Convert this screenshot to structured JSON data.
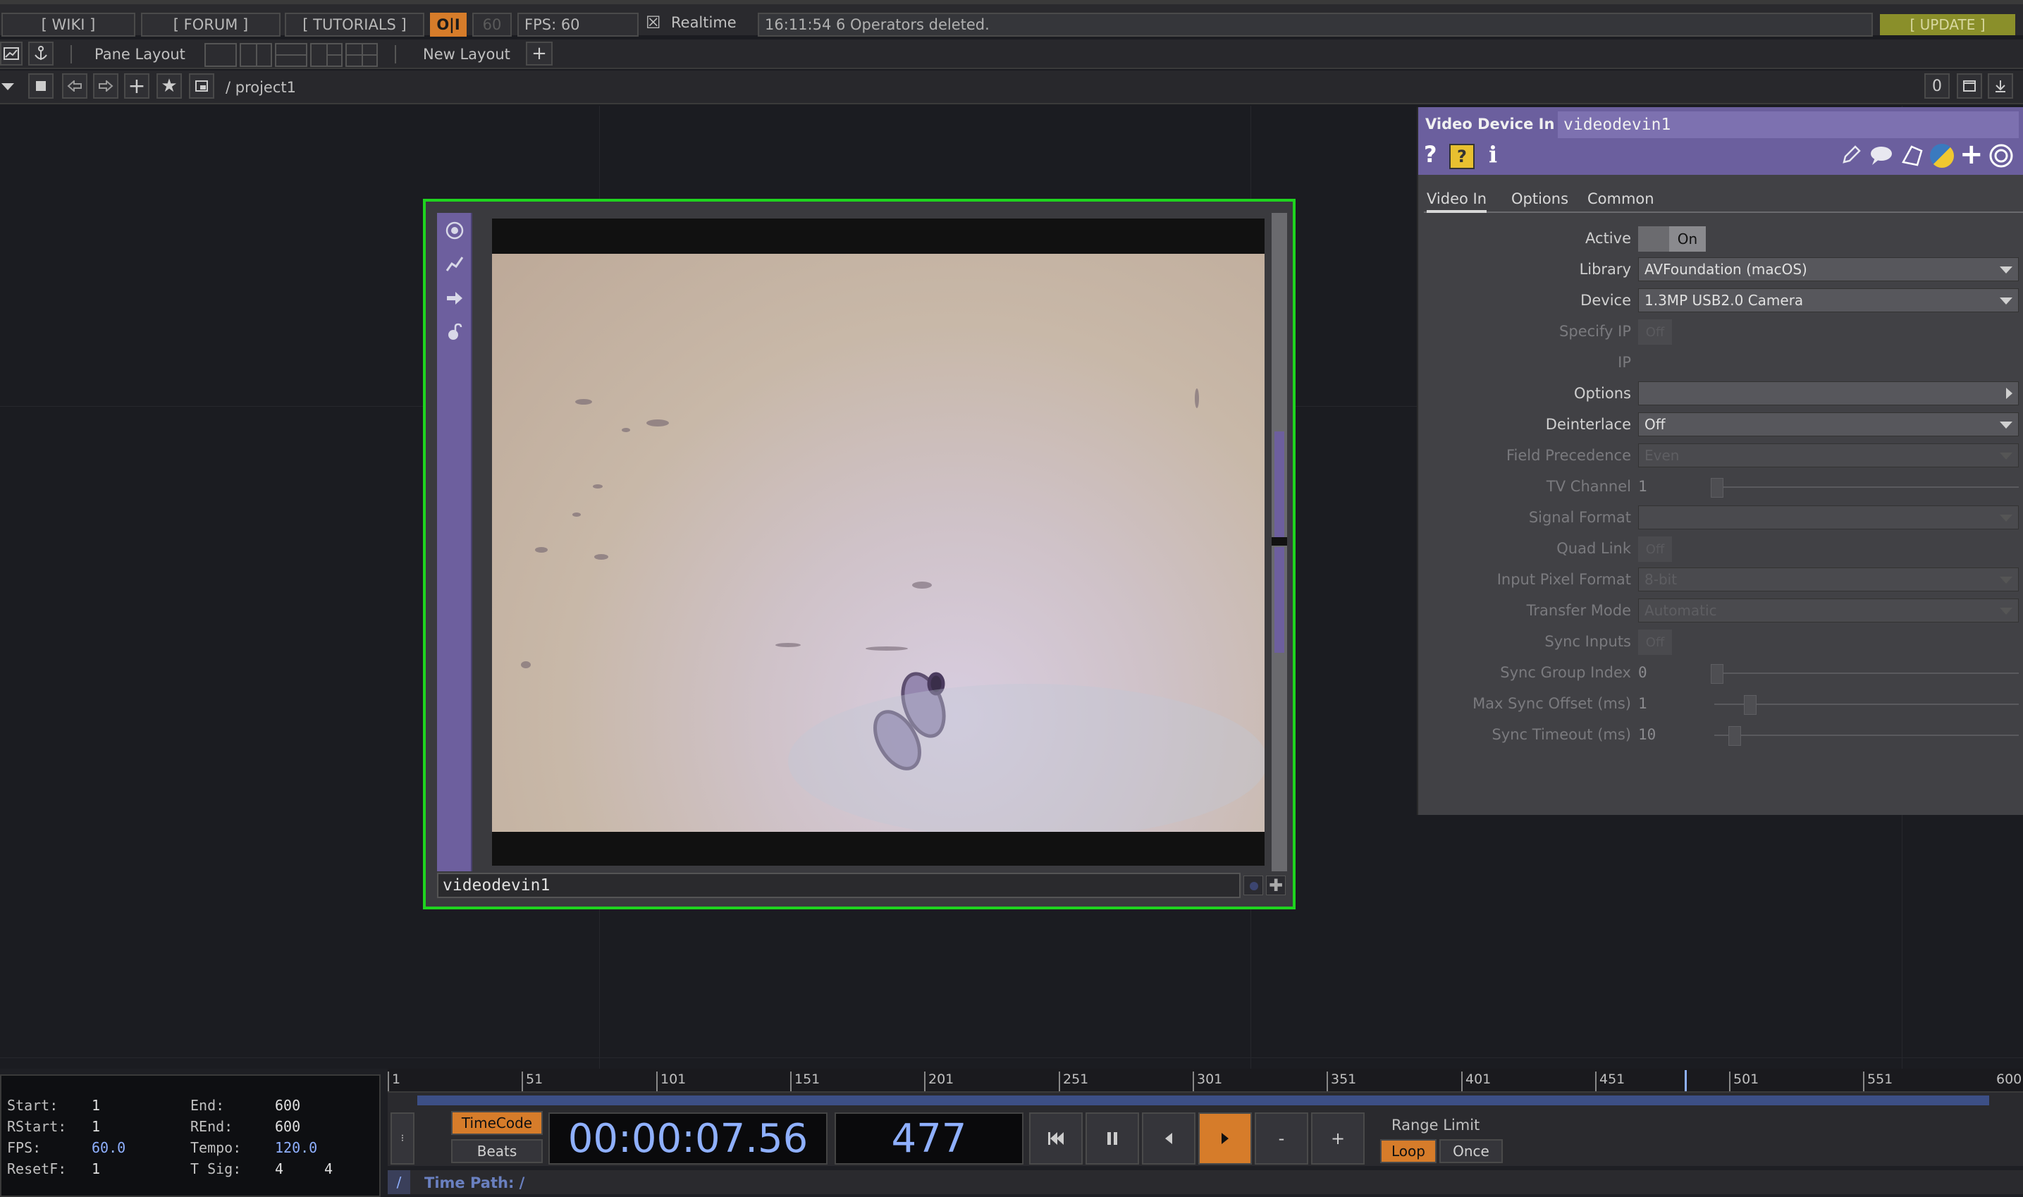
{
  "topbar": {
    "wiki": "[ WIKI ]",
    "forum": "[ FORUM ]",
    "tutorials": "[ TUTORIALS ]",
    "oi": "O|I",
    "fps_limit": "60",
    "fps_readout": "FPS:  60",
    "realtime_label": "Realtime",
    "realtime_check": "☒",
    "status_message": "16:11:54 6 Operators deleted.",
    "update": "[ UPDATE ]"
  },
  "toolbar": {
    "pane_layout": "Pane Layout",
    "new_layout": "New Layout",
    "add": "+"
  },
  "pathbar": {
    "path": "/ project1",
    "right_counter": "0"
  },
  "node": {
    "name": "videodevin1"
  },
  "param": {
    "op_type": "Video Device In",
    "op_name": "videodevin1",
    "tabs": [
      "Video In",
      "Options",
      "Common"
    ],
    "active_tab": "Video In",
    "rows": [
      {
        "label": "Active",
        "kind": "toggle",
        "value": "On",
        "disabled": false
      },
      {
        "label": "Library",
        "kind": "menu",
        "value": "AVFoundation (macOS)",
        "disabled": false
      },
      {
        "label": "Device",
        "kind": "menu",
        "value": "1.3MP USB2.0 Camera",
        "disabled": false
      },
      {
        "label": "Specify IP",
        "kind": "toggle",
        "value": "Off",
        "disabled": true
      },
      {
        "label": "IP",
        "kind": "none",
        "value": "",
        "disabled": true
      },
      {
        "label": "Options",
        "kind": "submenu",
        "value": "",
        "disabled": false
      },
      {
        "label": "Deinterlace",
        "kind": "menu",
        "value": "Off",
        "disabled": false
      },
      {
        "label": "Field Precedence",
        "kind": "menu",
        "value": "Even",
        "disabled": true
      },
      {
        "label": "TV Channel",
        "kind": "slider",
        "value": "1",
        "disabled": true
      },
      {
        "label": "Signal Format",
        "kind": "menu",
        "value": "",
        "disabled": true
      },
      {
        "label": "Quad Link",
        "kind": "toggle",
        "value": "Off",
        "disabled": true
      },
      {
        "label": "Input Pixel Format",
        "kind": "menu",
        "value": "8-bit",
        "disabled": true
      },
      {
        "label": "Transfer Mode",
        "kind": "menu",
        "value": "Automatic",
        "disabled": true
      },
      {
        "label": "Sync Inputs",
        "kind": "toggle",
        "value": "Off",
        "disabled": true
      },
      {
        "label": "Sync Group Index",
        "kind": "slider",
        "value": "0",
        "disabled": true
      },
      {
        "label": "Max Sync Offset (ms)",
        "kind": "slider",
        "value": "1",
        "disabled": true
      },
      {
        "label": "Sync Timeout (ms)",
        "kind": "slider",
        "value": "10",
        "disabled": true
      }
    ]
  },
  "timeline": {
    "info": {
      "start_label": "Start:",
      "start": "1",
      "end_label": "End:",
      "end": "600",
      "rstart_label": "RStart:",
      "rstart": "1",
      "rend_label": "REnd:",
      "rend": "600",
      "fps_label": "FPS:",
      "fps": "60.0",
      "tempo_label": "Tempo:",
      "tempo": "120.0",
      "resetf_label": "ResetF:",
      "resetf": "1",
      "tsig_label": "T Sig:",
      "tsig_a": "4",
      "tsig_b": "4"
    },
    "ticks": [
      "1",
      "51",
      "101",
      "151",
      "201",
      "251",
      "301",
      "351",
      "401",
      "451",
      "501",
      "551",
      "600"
    ],
    "timecode_btn": "TimeCode",
    "beats_btn": "Beats",
    "timecode": "00:00:07.56",
    "frame": "477",
    "minus": "-",
    "plus": "+",
    "range_limit": "Range Limit",
    "loop": "Loop",
    "once": "Once",
    "time_path": "Time Path: /",
    "slash": "/"
  }
}
